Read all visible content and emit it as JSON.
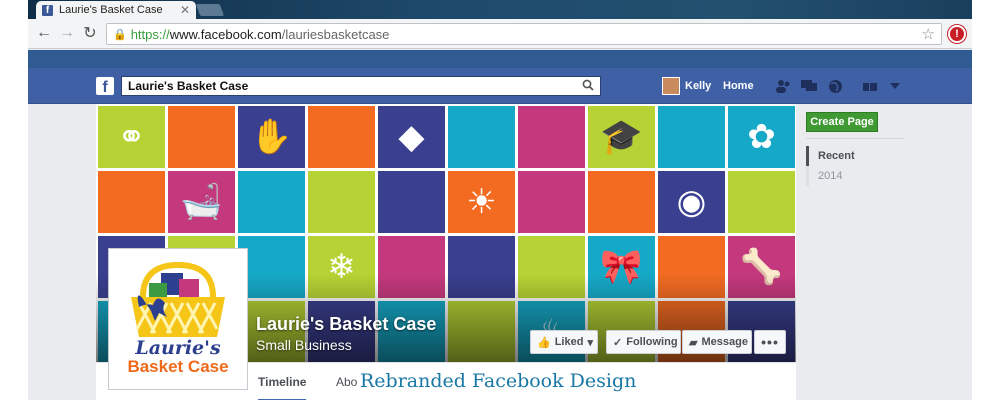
{
  "browser": {
    "tab_title": "Laurie's Basket Case",
    "tab_close": "✕",
    "url_protocol": "https://",
    "url_host": "www.facebook.com",
    "url_path": "/lauriesbasketcase"
  },
  "fb": {
    "search_value": "Laurie's Basket Case",
    "user_name": "Kelly",
    "home_label": "Home"
  },
  "page": {
    "name": "Laurie's Basket Case",
    "category": "Small Business",
    "logo_line1": "Laurie's",
    "logo_line2": "Basket Case",
    "buttons": {
      "liked": "Liked",
      "following": "Following",
      "message": "Message",
      "more": "•••"
    },
    "tabs": {
      "timeline": "Timeline",
      "about": "Abo"
    },
    "caption": "Rebranded Facebook Design"
  },
  "sidebar": {
    "create_page": "Create Page",
    "years": [
      "Recent",
      "2014"
    ]
  },
  "cover_tiles": [
    [
      "#b5d334",
      "#f26b21",
      "#3a3f8f",
      "#f26b21",
      "#3a3f8f",
      "#16a9c7",
      "#c4397d",
      "#b5d334",
      "#16a9c7",
      "#16a9c7"
    ],
    [
      "#f26b21",
      "#c4397d",
      "#16a9c7",
      "#b5d334",
      "#3a3f8f",
      "#f26b21",
      "#c4397d",
      "#f26b21",
      "#3a3f8f",
      "#b5d334"
    ],
    [
      "#3a3f8f",
      "#b5d334",
      "#16a9c7",
      "#b5d334",
      "#c4397d",
      "#3a3f8f",
      "#b5d334",
      "#16a9c7",
      "#f26b21",
      "#c4397d"
    ],
    [
      "#16a9c7",
      "#f26b21",
      "#b5d334",
      "#3a3f8f",
      "#16a9c7",
      "#b5d334",
      "#16a9c7",
      "#b5d334",
      "#f26b21",
      "#3a3f8f"
    ]
  ],
  "cover_icons": [
    {
      "row": 0,
      "col": 0,
      "icon": "rings-icon",
      "glyph": "⚭"
    },
    {
      "row": 0,
      "col": 2,
      "icon": "mitten-icon",
      "glyph": "✋"
    },
    {
      "row": 0,
      "col": 4,
      "icon": "candy-icon",
      "glyph": "◆"
    },
    {
      "row": 0,
      "col": 7,
      "icon": "graduation-cap-icon",
      "glyph": "🎓"
    },
    {
      "row": 0,
      "col": 9,
      "icon": "flower-icon",
      "glyph": "✿"
    },
    {
      "row": 1,
      "col": 1,
      "icon": "bathtub-icon",
      "glyph": "🛁"
    },
    {
      "row": 1,
      "col": 5,
      "icon": "sun-icon",
      "glyph": "☀"
    },
    {
      "row": 1,
      "col": 8,
      "icon": "pacifier-icon",
      "glyph": "◉"
    },
    {
      "row": 2,
      "col": 3,
      "icon": "snowflake-icon",
      "glyph": "❄"
    },
    {
      "row": 2,
      "col": 7,
      "icon": "bow-icon",
      "glyph": "🎀"
    },
    {
      "row": 2,
      "col": 9,
      "icon": "bone-icon",
      "glyph": "🦴"
    },
    {
      "row": 3,
      "col": 6,
      "icon": "steaming-dish-icon",
      "glyph": "♨"
    }
  ],
  "colors": {
    "fb_blue": "#4060a6",
    "accent_green": "#3f9a34",
    "logo_navy": "#2d3f8f",
    "logo_orange": "#ef6a1a",
    "caption_blue": "#1877a6"
  }
}
